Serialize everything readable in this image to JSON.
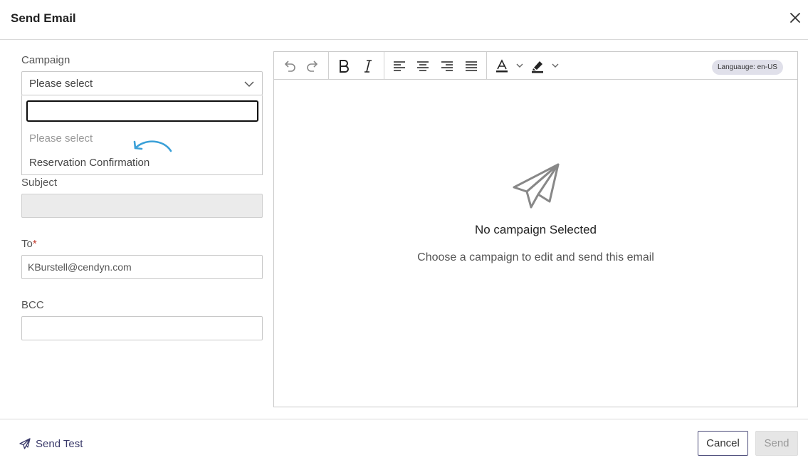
{
  "dialog": {
    "title": "Send Email"
  },
  "campaign": {
    "label": "Campaign",
    "selected": "Please select",
    "search_value": "",
    "options": [
      "Please select",
      "Reservation Confirmation"
    ]
  },
  "subject": {
    "label": "Subject",
    "value": ""
  },
  "to": {
    "label": "To",
    "required_mark": "*",
    "value": "KBurstell@cendyn.com"
  },
  "bcc": {
    "label": "BCC",
    "value": ""
  },
  "editor": {
    "language_badge": "Languauge: en-US",
    "empty_title": "No campaign Selected",
    "empty_subtitle": "Choose a campaign to edit and send this email",
    "toolbar_icons": [
      "undo-icon",
      "redo-icon",
      "bold-icon",
      "italic-icon",
      "align-left-icon",
      "align-center-icon",
      "align-right-icon",
      "align-justify-icon",
      "text-color-icon",
      "highlight-icon"
    ]
  },
  "footer": {
    "send_test_label": "Send Test",
    "cancel_label": "Cancel",
    "send_label": "Send"
  },
  "colors": {
    "accent": "#4a4a78",
    "hint_arrow": "#3aa0d8",
    "required": "#c0392b"
  }
}
